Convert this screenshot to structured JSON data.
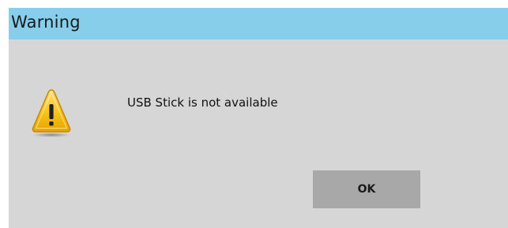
{
  "window": {
    "title": "Warning"
  },
  "dialog": {
    "icon": "warning-triangle-icon",
    "message": "USB Stick is not available",
    "ok_label": "OK"
  },
  "colors": {
    "titlebar": "#87ceea",
    "dialog_background": "#d6d6d6",
    "button_background": "#a8a8a8",
    "icon_fill": "#f5b800"
  }
}
